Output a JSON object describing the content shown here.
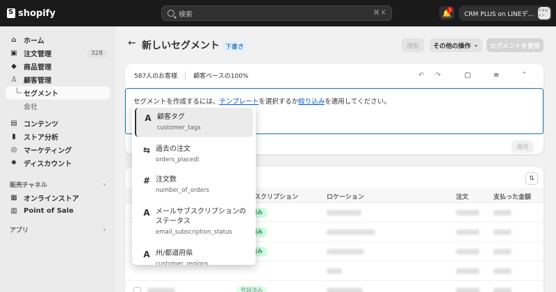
{
  "topbar": {
    "logo_text": "shopify",
    "search_placeholder": "検索",
    "search_shortcut": "⌘ K",
    "notification_count": "1",
    "store_name": "CRM PLUS on LINEデ…",
    "avatar_text": "デモサイト"
  },
  "sidebar": {
    "items": [
      {
        "label": "ホーム",
        "icon": "home-icon"
      },
      {
        "label": "注文管理",
        "icon": "inbox-icon",
        "badge": "328"
      },
      {
        "label": "商品管理",
        "icon": "tag-icon"
      },
      {
        "label": "顧客管理",
        "icon": "person-icon"
      }
    ],
    "sub_items": [
      {
        "label": "セグメント",
        "active": true
      },
      {
        "label": "会社",
        "active": false
      }
    ],
    "items2": [
      {
        "label": "コンテンツ",
        "icon": "content-icon"
      },
      {
        "label": "ストア分析",
        "icon": "chart-icon"
      },
      {
        "label": "マーケティング",
        "icon": "target-icon"
      },
      {
        "label": "ディスカウント",
        "icon": "discount-icon"
      }
    ],
    "sales_channels_label": "販売チャネル",
    "channels": [
      {
        "label": "オンラインストア",
        "icon": "store-icon"
      },
      {
        "label": "Point of Sale",
        "icon": "pos-icon"
      }
    ],
    "apps_label": "アプリ"
  },
  "header": {
    "title": "新しいセグメント",
    "status": "下書き",
    "duplicate_label": "複製",
    "more_actions_label": "その他の操作",
    "use_segment_label": "セグメントを使用"
  },
  "editor": {
    "customer_count": "587人のお客様",
    "customer_percent": "顧客ベースの100%",
    "text_before": "セグメントを作成するには、",
    "template_link": "テンプレート",
    "text_middle": "を選択するか",
    "filter_link": "絞り込み",
    "text_after": "を適用してください。",
    "apply_label": "適用"
  },
  "table": {
    "columns": [
      "サブスクリプション",
      "ロケーション",
      "注文",
      "支払った金額"
    ],
    "pill_label": "登録済み"
  },
  "dropdown": [
    {
      "icon": "A",
      "title": "顧客タグ",
      "field": "customer_tags",
      "selected": true
    },
    {
      "icon": "⇆",
      "title": "過去の注文",
      "field": "orders_placed(",
      "selected": false
    },
    {
      "icon": "#",
      "title": "注文数",
      "field": "number_of_orders",
      "selected": false
    },
    {
      "icon": "A",
      "title": "メールサブスクリプションのステータス",
      "field": "email_subscription_status",
      "selected": false
    },
    {
      "icon": "A",
      "title": "州/都道府県",
      "field": "customer_regions",
      "selected": false
    }
  ],
  "colors": {
    "topbar_bg": "#1a1a1a",
    "link": "#005bd3",
    "editor_border": "#1a6fa8",
    "pill_bg": "#cdfee1"
  }
}
